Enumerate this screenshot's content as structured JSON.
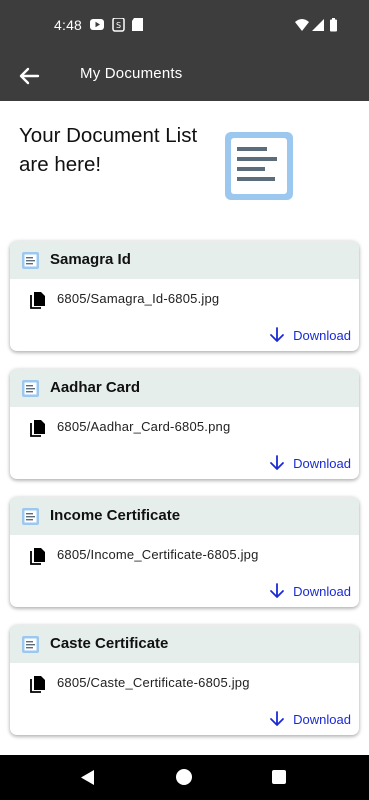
{
  "status_bar": {
    "time": "4:48",
    "left_icons": [
      "youtube-icon",
      "sim-icon",
      "sd-card-icon"
    ],
    "right_icons": [
      "wifi-icon",
      "signal-icon",
      "battery-icon"
    ]
  },
  "app_bar": {
    "title": "My Documents",
    "back_icon": "arrow-left-icon"
  },
  "hero": {
    "heading": "Your Document List are here!",
    "illustration": "document-list-icon"
  },
  "documents": [
    {
      "title": "Samagra Id",
      "file": "6805/Samagra_Id-6805.jpg",
      "download_label": "Download"
    },
    {
      "title": "Aadhar Card",
      "file": "6805/Aadhar_Card-6805.png",
      "download_label": "Download"
    },
    {
      "title": "Income Certificate",
      "file": "6805/Income_Certificate-6805.jpg",
      "download_label": "Download"
    },
    {
      "title": "Caste Certificate",
      "file": "6805/Caste_Certificate-6805.jpg",
      "download_label": "Download"
    }
  ],
  "colors": {
    "app_bar_bg": "#3d3d3d",
    "card_header_bg": "#e5eeeb",
    "download_link": "#1a2bd6",
    "doc_icon_blue": "#4a90e2"
  }
}
